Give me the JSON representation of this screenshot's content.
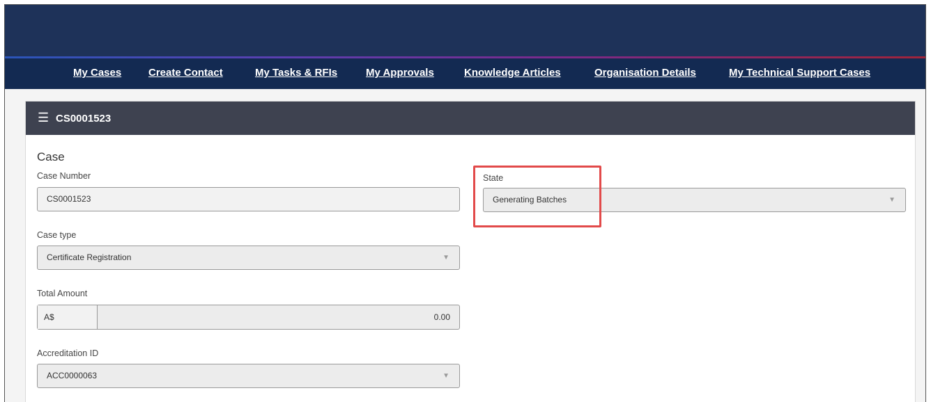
{
  "nav": {
    "links": [
      "My Cases",
      "Create Contact",
      "My Tasks & RFIs",
      "My Approvals",
      "Knowledge Articles",
      "Organisation Details",
      "My Technical Support Cases"
    ]
  },
  "case": {
    "header_id": "CS0001523",
    "section_title": "Case",
    "case_number_label": "Case Number",
    "case_number_value": "CS0001523",
    "case_type_label": "Case type",
    "case_type_value": "Certificate Registration",
    "total_amount_label": "Total Amount",
    "currency": "A$",
    "amount": "0.00",
    "accreditation_label": "Accreditation ID",
    "accreditation_value": "ACC0000063",
    "state_label": "State",
    "state_value": "Generating Batches"
  },
  "icons": {
    "menu": "hamburger-icon",
    "dropdown": "caret-down-icon"
  },
  "colors": {
    "banner": "#1e3259",
    "nav": "#132a52",
    "panel_header": "#3e4250",
    "highlight": "#e24a4a"
  }
}
